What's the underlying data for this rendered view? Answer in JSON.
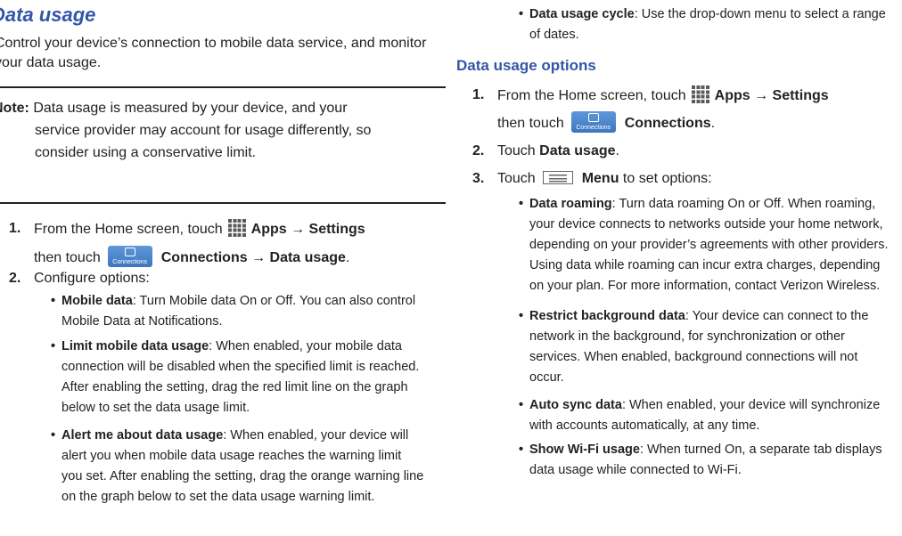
{
  "left": {
    "title": "Data usage",
    "intro": "Control your device’s connection to mobile data service, and monitor your data usage.",
    "note": {
      "label": "Note:",
      "line1": " Data usage is measured by your device, and your",
      "line2": "service provider may account for usage differently, so",
      "line3": "consider using a conservative limit."
    },
    "step1": {
      "num": "1.",
      "pre": "From the Home screen, touch",
      "apps": "Apps",
      "arrow1": " → ",
      "settings": "Settings",
      "then": "then touch",
      "icon_caption": "Connections",
      "connections": "Connections",
      "arrow2": " → ",
      "data_usage": "Data usage",
      "end": "."
    },
    "step2": {
      "num": "2.",
      "text": "Configure options:"
    },
    "bullets": [
      {
        "head": "Mobile data",
        "line1": ": Turn Mobile data On or Off. You can also control",
        "line2": "Mobile Data at Notifications."
      },
      {
        "head": "Limit mobile data usage",
        "line1": ": When enabled, your mobile data",
        "line2": "connection will be disabled when the specified limit is reached.",
        "line3": "After enabling the setting, drag the red limit line on the graph",
        "line4": "below to set the data usage limit."
      },
      {
        "head": "Alert me about data usage",
        "line1": ": When enabled, your device will",
        "line2": "alert you when mobile data usage reaches the warning limit",
        "line3": "you set. After enabling the setting, drag the orange warning line",
        "line4": "on the graph below to set the data usage warning limit."
      }
    ]
  },
  "right": {
    "cycle": {
      "head": "Data usage cycle",
      "line1": ": Use the drop-down menu to select a range",
      "line2": "of dates."
    },
    "options_title": "Data usage options",
    "step1": {
      "num": "1.",
      "pre": "From the Home screen, touch",
      "apps": "Apps",
      "arrow1": " → ",
      "settings": "Settings",
      "then": "then touch",
      "icon_caption": "Connections",
      "connections": "Connections",
      "end": "."
    },
    "step2": {
      "num": "2.",
      "pre": "Touch ",
      "bold": "Data usage",
      "end": "."
    },
    "step3": {
      "num": "3.",
      "pre": "Touch",
      "bold": "Menu",
      "end": " to set options:"
    },
    "bullets": [
      {
        "head": "Data roaming",
        "line1": ": Turn data roaming On or Off. When roaming,",
        "line2": "your device connects to networks outside your home network,",
        "line3": "depending on your provider’s agreements with other providers.",
        "line4": "Using data while roaming can incur extra charges, depending",
        "line5": "on your plan. For more information, contact Verizon Wireless."
      },
      {
        "head": "Restrict background data",
        "line1": ": Your device can connect to the",
        "line2": "network in the background, for synchronization or other",
        "line3": "services. When enabled, background connections will not",
        "line4": "occur."
      },
      {
        "head": "Auto sync data",
        "line1": ": When enabled, your device will synchronize",
        "line2": "with accounts automatically, at any time."
      },
      {
        "head": "Show Wi-Fi usage",
        "line1": ": When turned On, a separate tab displays",
        "line2": "data usage while connected to Wi-Fi."
      }
    ]
  }
}
